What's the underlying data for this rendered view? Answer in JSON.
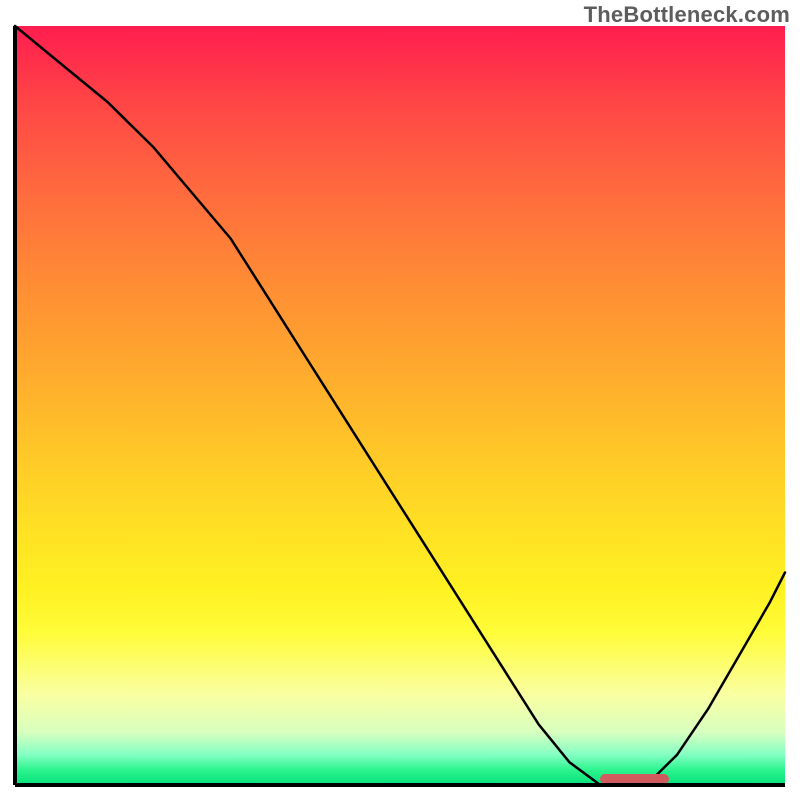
{
  "watermark": "TheBottleneck.com",
  "colors": {
    "axis": "#000000",
    "curve": "#000000",
    "marker": "#cf5b5e",
    "gradient_top": "#ff1d4f",
    "gradient_bottom": "#05e07a"
  },
  "chart_data": {
    "type": "line",
    "title": "",
    "xlabel": "",
    "ylabel": "",
    "xlim": [
      0,
      100
    ],
    "ylim": [
      0,
      100
    ],
    "grid": false,
    "legend": false,
    "series": [
      {
        "name": "curve",
        "x": [
          0,
          6,
          12,
          18,
          23,
          28,
          33,
          38,
          43,
          48,
          53,
          58,
          63,
          68,
          72,
          76,
          79,
          82,
          86,
          90,
          94,
          98,
          100
        ],
        "values": [
          100,
          95,
          90,
          84,
          78,
          72,
          64,
          56,
          48,
          40,
          32,
          24,
          16,
          8,
          3,
          0,
          0,
          0,
          4,
          10,
          17,
          24,
          28
        ]
      }
    ],
    "marker": {
      "x_start": 76,
      "x_end": 85,
      "y": 0.8
    },
    "note": "Axes are unlabeled in the source image; values are read off the geometry (0–100 normalized)."
  }
}
